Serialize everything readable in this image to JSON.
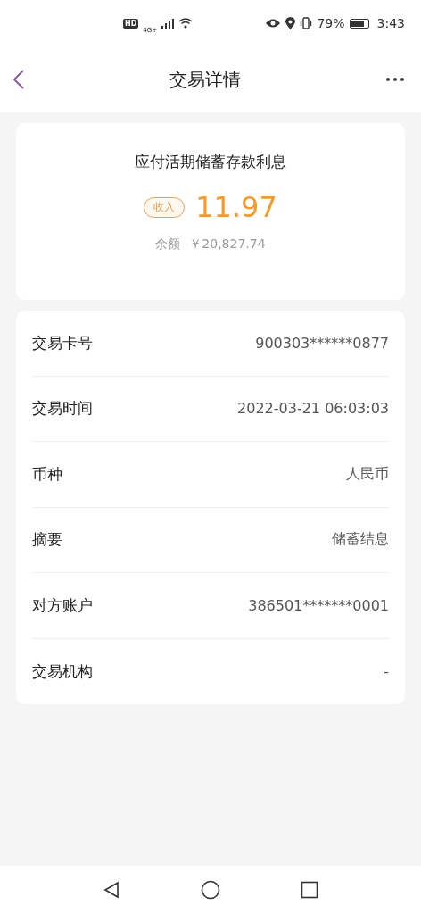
{
  "status_bar": {
    "hd": "HD",
    "network": "4G+",
    "battery_percent": "79%",
    "time": "3:43"
  },
  "header": {
    "title": "交易详情"
  },
  "summary": {
    "title": "应付活期储蓄存款利息",
    "tag": "收入",
    "amount": "11.97",
    "balance_label": "余额",
    "balance": "￥20,827.74"
  },
  "details": [
    {
      "label": "交易卡号",
      "value": "900303******0877"
    },
    {
      "label": "交易时间",
      "value": "2022-03-21 06:03:03"
    },
    {
      "label": "币种",
      "value": "人民币"
    },
    {
      "label": "摘要",
      "value": "储蓄结息"
    },
    {
      "label": "对方账户",
      "value": "386501*******0001"
    },
    {
      "label": "交易机构",
      "value": "-"
    }
  ]
}
